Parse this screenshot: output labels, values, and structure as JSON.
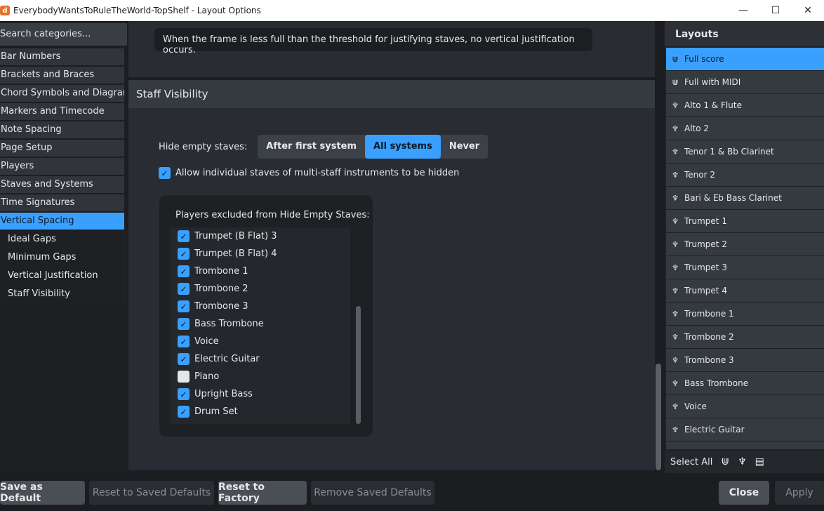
{
  "window": {
    "title": "EverybodyWantsToRuleTheWorld-TopShelf - Layout Options",
    "minimize": "—",
    "maximize": "☐",
    "close": "✕"
  },
  "sidebar": {
    "search_placeholder": "Search categories...",
    "categories": [
      "Bar Numbers",
      "Brackets and Braces",
      "Chord Symbols and Diagrams",
      "Markers and Timecode",
      "Note Spacing",
      "Page Setup",
      "Players",
      "Staves and Systems",
      "Time Signatures",
      "Vertical Spacing"
    ],
    "selected_category": "Vertical Spacing",
    "subcategories": [
      "Ideal Gaps",
      "Minimum Gaps",
      "Vertical Justification",
      "Staff Visibility"
    ]
  },
  "main": {
    "info_text": "When the frame is less full than the threshold for justifying staves, no vertical justification occurs.",
    "section_title": "Staff Visibility",
    "hide_empty_label": "Hide empty staves:",
    "hide_options": [
      "After first system",
      "All systems",
      "Never"
    ],
    "hide_selected": "All systems",
    "allow_label": "Allow individual staves of multi-staff instruments to be hidden",
    "allow_checked": true,
    "players_title": "Players excluded from Hide Empty Staves:",
    "players": [
      {
        "name": "Trumpet (B Flat) 3",
        "checked": true
      },
      {
        "name": "Trumpet (B Flat) 4",
        "checked": true
      },
      {
        "name": "Trombone 1",
        "checked": true
      },
      {
        "name": "Trombone 2",
        "checked": true
      },
      {
        "name": "Trombone 3",
        "checked": true
      },
      {
        "name": "Bass Trombone",
        "checked": true
      },
      {
        "name": "Voice",
        "checked": true
      },
      {
        "name": "Electric Guitar",
        "checked": true
      },
      {
        "name": "Piano",
        "checked": false
      },
      {
        "name": "Upright Bass",
        "checked": true
      },
      {
        "name": "Drum Set",
        "checked": true
      }
    ]
  },
  "layouts": {
    "title": "Layouts",
    "items": [
      {
        "name": "Full score",
        "icon": "full-score-icon"
      },
      {
        "name": "Full with MIDI",
        "icon": "full-score-icon"
      },
      {
        "name": "Alto 1 & Flute",
        "icon": "part-icon"
      },
      {
        "name": "Alto 2",
        "icon": "part-icon"
      },
      {
        "name": "Tenor 1  & Bb Clarinet",
        "icon": "part-icon"
      },
      {
        "name": "Tenor 2",
        "icon": "part-icon"
      },
      {
        "name": "Bari & Eb Bass Clarinet",
        "icon": "part-icon"
      },
      {
        "name": "Trumpet 1",
        "icon": "part-icon"
      },
      {
        "name": "Trumpet 2",
        "icon": "part-icon"
      },
      {
        "name": "Trumpet 3",
        "icon": "part-icon"
      },
      {
        "name": "Trumpet 4",
        "icon": "part-icon"
      },
      {
        "name": "Trombone 1",
        "icon": "part-icon"
      },
      {
        "name": "Trombone 2",
        "icon": "part-icon"
      },
      {
        "name": "Trombone 3",
        "icon": "part-icon"
      },
      {
        "name": "Bass Trombone",
        "icon": "part-icon"
      },
      {
        "name": "Voice",
        "icon": "part-icon"
      },
      {
        "name": "Electric Guitar",
        "icon": "part-icon"
      },
      {
        "name": "",
        "icon": "part-icon"
      }
    ],
    "selected": "Full score",
    "select_all_label": "Select All"
  },
  "footer": {
    "save_default": "Save as Default",
    "reset_saved": "Reset to Saved Defaults",
    "reset_factory": "Reset to Factory",
    "remove_saved": "Remove Saved Defaults",
    "close": "Close",
    "apply": "Apply"
  },
  "colors": {
    "accent": "#3aa0ff",
    "background": "#24272c",
    "panel": "#292c32"
  }
}
